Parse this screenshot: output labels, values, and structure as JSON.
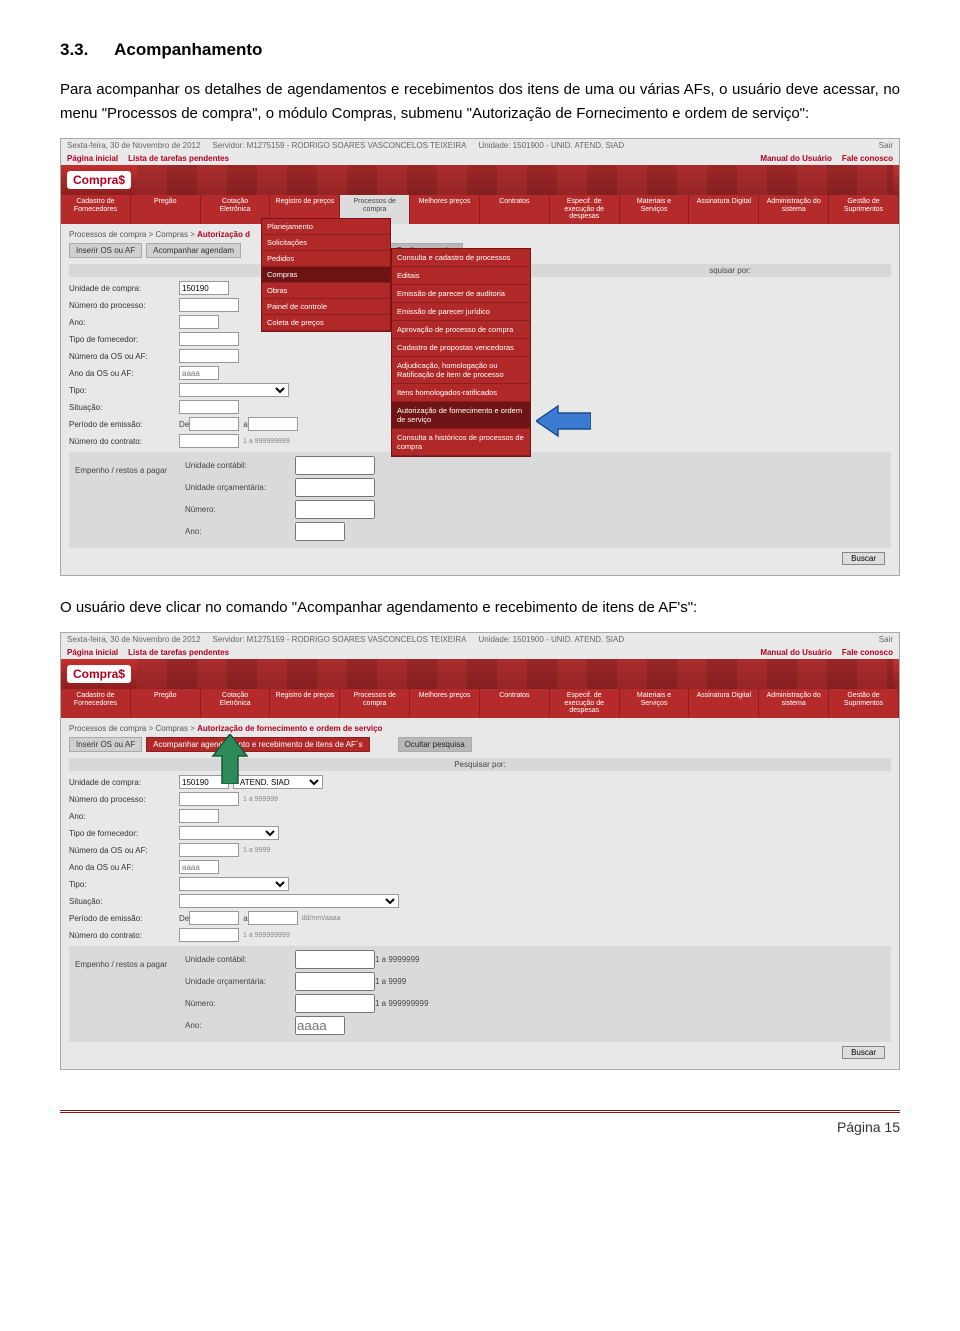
{
  "section": {
    "number": "3.3.",
    "title": "Acompanhamento"
  },
  "para1": "Para acompanhar os detalhes de agendamentos e recebimentos dos itens de uma ou várias AFs, o usuário deve acessar, no menu \"Processos de compra\", o módulo Compras, submenu \"Autorização de Fornecimento e ordem de serviço\":",
  "para2": "O usuário deve clicar no comando \"Acompanhar agendamento e recebimento de itens de AF's\":",
  "footer": "Página 15",
  "shot": {
    "topbar": {
      "date": "Sexta-feira, 30 de Novembro de 2012",
      "server": "Servidor: M1275159 - RODRIGO SOARES VASCONCELOS TEIXEIRA",
      "unit": "Unidade: 1501900 - UNID. ATEND. SIAD",
      "sair": "Sair"
    },
    "navrow": {
      "home": "Página inicial",
      "tasks": "Lista de tarefas pendentes",
      "manual": "Manual do Usuário",
      "fale": "Fale conosco"
    },
    "logo": "Compra$",
    "menu": [
      "Cadastro de Fornecedores",
      "Pregão",
      "Cotação Eletrônica",
      "Registro de preços",
      "Processos de compra",
      "Melhores preços",
      "Contratos",
      "Especif. de execução de despesas",
      "Materiais e Serviços",
      "Assinatura Digital",
      "Administração do sistema",
      "Gestão de Suprimentos"
    ],
    "breadcrumb_prefix": "Processos de compra > Compras > ",
    "breadcrumb_bold_short": "Autorização d",
    "breadcrumb_bold_full": "Autorização de fornecimento e ordem de serviço",
    "tabs": {
      "inserir": "Inserir OS ou AF",
      "acompanhar_short": "Acompanhar agendam",
      "acompanhar_full": "Acompanhar agendamento e recebimento de itens de AF´s",
      "ocultar": "Ocultar pesquisa"
    },
    "search_header_suffix": "squisar por:",
    "search_header_full": "Pesquisar por:",
    "form": {
      "unidade": "Unidade de compra:",
      "unidade_val": "150190",
      "unidade_sel": "ATEND. SIAD",
      "processo": "Número do processo:",
      "processo_hint": "1 a 999999",
      "ano": "Ano:",
      "tipo_forn": "Tipo de fornecedor:",
      "num_os": "Número da OS ou AF:",
      "num_os_hint": "1 a 9999",
      "ano_os": "Ano da OS ou AF:",
      "ano_os_ph": "aaaa",
      "tipo": "Tipo:",
      "situacao": "Situação:",
      "periodo": "Período de emissão:",
      "de": "De",
      "a": "a",
      "periodo_ph": "dd/mm/aaaa",
      "contrato": "Número do contrato:",
      "contrato_hint": "1 a 999999999",
      "empenho": "Empenho / restos a pagar",
      "uc": "Unidade contábil:",
      "uc_hint": "1 a 9999999",
      "uo": "Unidade orçamentária:",
      "uo_hint": "1 a 9999",
      "num": "Número:",
      "num_hint": "1 a 999999999",
      "ano2": "Ano:",
      "ano2_ph": "aaaa"
    },
    "dropdown1": [
      "Planejamento",
      "Solicitações",
      "Pedidos",
      "Compras",
      "Obras",
      "Painel de controle",
      "Coleta de preços"
    ],
    "dropdown2": [
      "Consulta e cadastro de processos",
      "Editais",
      "Emissão de parecer de auditoria",
      "Emissão de parecer jurídico",
      "Aprovação de processo de compra",
      "Cadastro de propostas vencedoras",
      "Adjudicação, homologação ou Ratificação de item de processo",
      "Itens homologados-ratificados",
      "Autorização de fornecimento e ordem de serviço",
      "Consulta a históricos de processos de compra"
    ],
    "buscar": "Buscar"
  }
}
